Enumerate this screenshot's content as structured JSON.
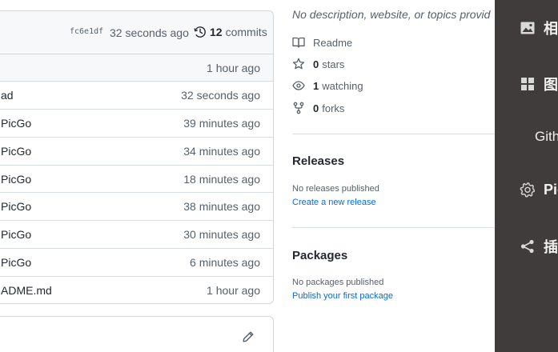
{
  "files": {
    "commit_bar": {
      "sha": "fc6e1df",
      "time": "32 seconds ago",
      "commits_count": "12",
      "commits_label": "commits"
    },
    "rows": [
      {
        "name": "",
        "time": "1 hour ago"
      },
      {
        "name": "ad",
        "time": "32 seconds ago"
      },
      {
        "name": " PicGo",
        "time": "39 minutes ago"
      },
      {
        "name": " PicGo",
        "time": "34 minutes ago"
      },
      {
        "name": " PicGo",
        "time": "18 minutes ago"
      },
      {
        "name": " PicGo",
        "time": "38 minutes ago"
      },
      {
        "name": " PicGo",
        "time": "30 minutes ago"
      },
      {
        "name": " PicGo",
        "time": "6 minutes ago"
      },
      {
        "name": "ADME.md",
        "time": "1 hour ago"
      }
    ]
  },
  "about": {
    "description": "No description, website, or topics provid",
    "readme_label": "Readme",
    "stars_count": "0",
    "stars_label": "stars",
    "watching_count": "1",
    "watching_label": "watching",
    "forks_count": "0",
    "forks_label": "forks"
  },
  "releases": {
    "title": "Releases",
    "status": "No releases published",
    "link": "Create a new release"
  },
  "packages": {
    "title": "Packages",
    "status": "No packages published",
    "link": "Publish your first package"
  },
  "overlay_menu": {
    "items": [
      {
        "icon": "image-icon",
        "label": "相"
      },
      {
        "icon": "grid-icon",
        "label": "图"
      },
      {
        "icon": "",
        "label": "Gith"
      },
      {
        "icon": "gear-icon",
        "label": "Pic"
      },
      {
        "icon": "share-icon",
        "label": "插"
      }
    ]
  }
}
